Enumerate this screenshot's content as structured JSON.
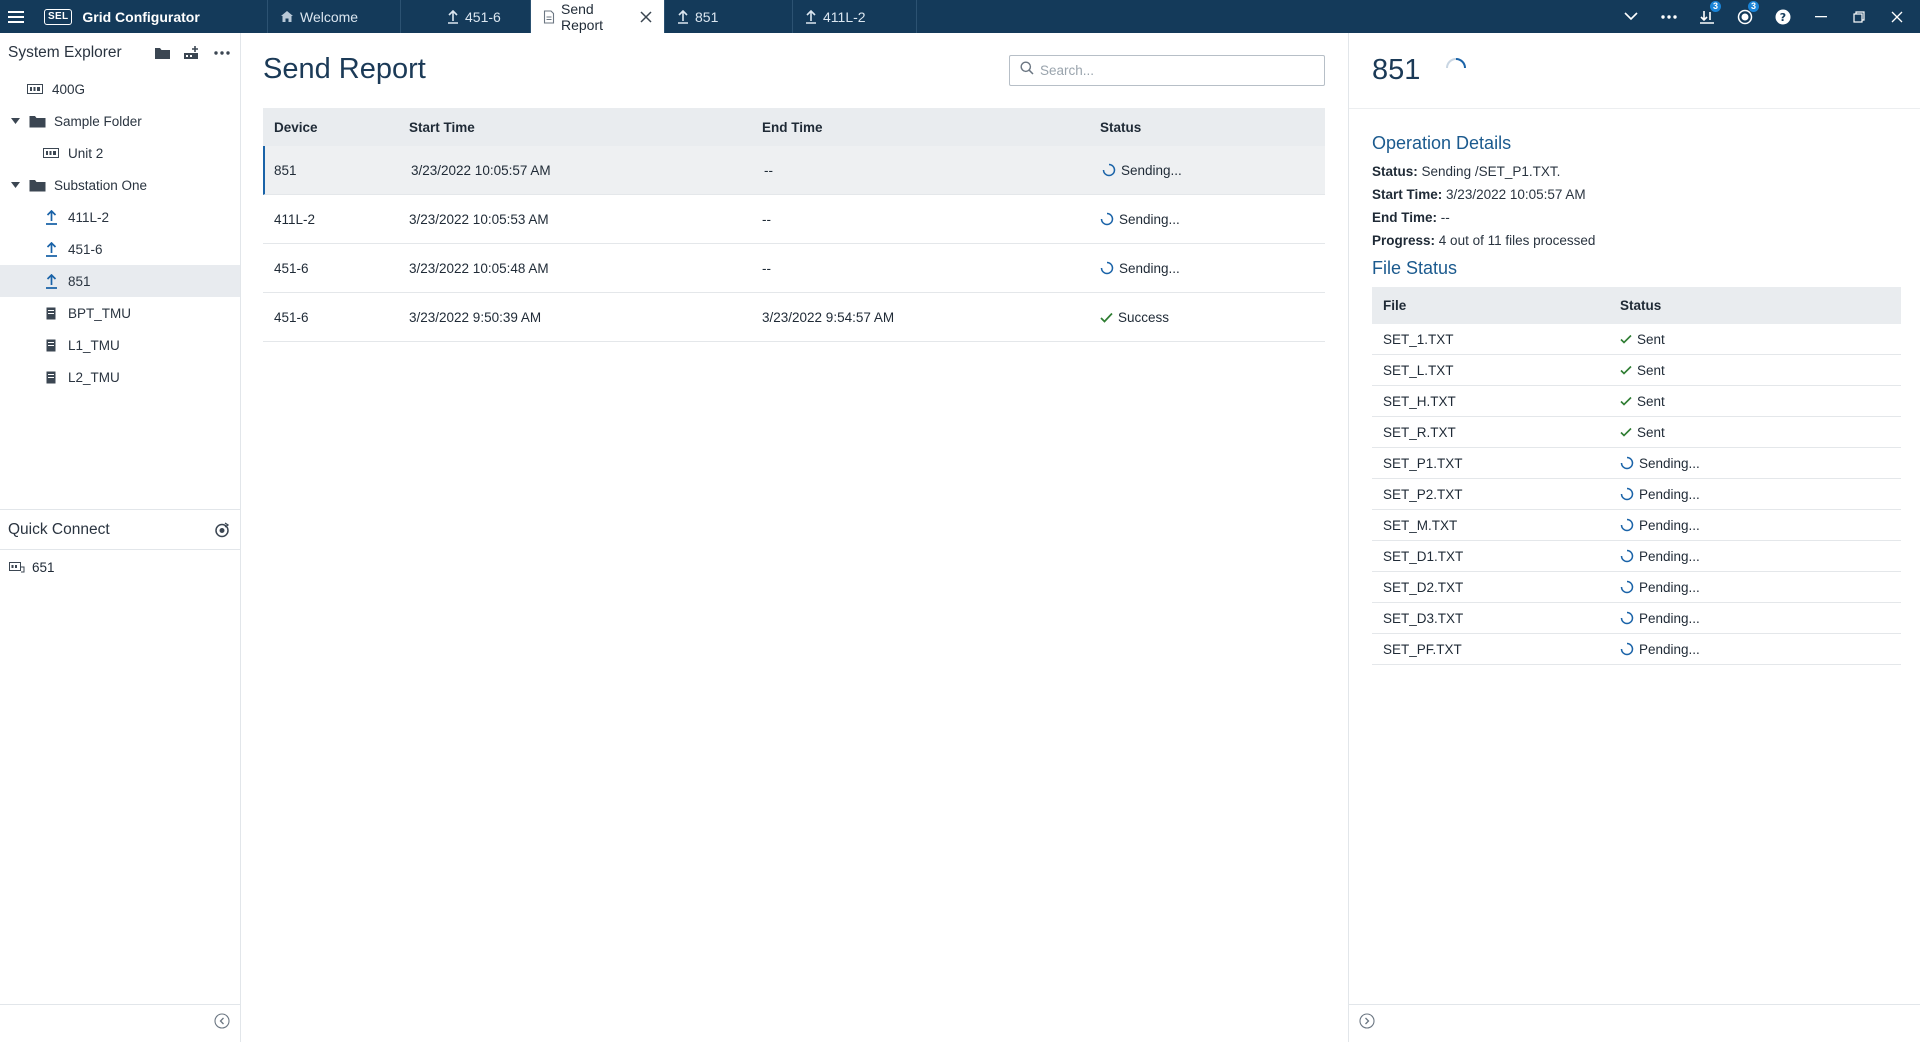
{
  "titlebar": {
    "logo": "SEL",
    "app_name": "Grid Configurator",
    "tabs": [
      {
        "label": "Welcome",
        "icon": "home-icon"
      },
      {
        "label": "451-6",
        "icon": "upload-icon"
      },
      {
        "label": "Send Report",
        "icon": "report-icon"
      },
      {
        "label": "851",
        "icon": "upload-icon"
      },
      {
        "label": "411L-2",
        "icon": "upload-icon"
      }
    ],
    "badges": {
      "transfers": "3",
      "notifications": "3"
    }
  },
  "sidebar": {
    "title": "System Explorer",
    "tree": [
      {
        "label": "400G"
      },
      {
        "label": "Sample Folder"
      },
      {
        "label": "Unit 2"
      },
      {
        "label": "Substation One"
      },
      {
        "label": "411L-2"
      },
      {
        "label": "451-6"
      },
      {
        "label": "851"
      },
      {
        "label": "BPT_TMU"
      },
      {
        "label": "L1_TMU"
      },
      {
        "label": "L2_TMU"
      }
    ],
    "quick_connect": {
      "title": "Quick Connect",
      "items": [
        {
          "label": "651"
        }
      ]
    }
  },
  "main": {
    "title": "Send Report",
    "search_placeholder": "Search...",
    "columns": {
      "device": "Device",
      "start": "Start Time",
      "end": "End Time",
      "status": "Status"
    },
    "rows": [
      {
        "device": "851",
        "start": "3/23/2022 10:05:57 AM",
        "end": "--",
        "status": "Sending..."
      },
      {
        "device": "411L-2",
        "start": "3/23/2022 10:05:53 AM",
        "end": "--",
        "status": "Sending..."
      },
      {
        "device": "451-6",
        "start": "3/23/2022 10:05:48 AM",
        "end": "--",
        "status": "Sending..."
      },
      {
        "device": "451-6",
        "start": "3/23/2022 9:50:39 AM",
        "end": "3/23/2022 9:54:57 AM",
        "status": "Success"
      }
    ]
  },
  "detail": {
    "title": "851",
    "op_title": "Operation Details",
    "status_label": "Status:",
    "status_value": "Sending /SET_P1.TXT.",
    "start_label": "Start Time:",
    "start_value": "3/23/2022 10:05:57 AM",
    "end_label": "End Time:",
    "end_value": "--",
    "progress_label": "Progress:",
    "progress_value": "4 out of 11 files processed",
    "fs_title": "File Status",
    "fs_columns": {
      "file": "File",
      "status": "Status"
    },
    "files": [
      {
        "file": "SET_1.TXT",
        "status": "Sent"
      },
      {
        "file": "SET_L.TXT",
        "status": "Sent"
      },
      {
        "file": "SET_H.TXT",
        "status": "Sent"
      },
      {
        "file": "SET_R.TXT",
        "status": "Sent"
      },
      {
        "file": "SET_P1.TXT",
        "status": "Sending..."
      },
      {
        "file": "SET_P2.TXT",
        "status": "Pending..."
      },
      {
        "file": "SET_M.TXT",
        "status": "Pending..."
      },
      {
        "file": "SET_D1.TXT",
        "status": "Pending..."
      },
      {
        "file": "SET_D2.TXT",
        "status": "Pending..."
      },
      {
        "file": "SET_D3.TXT",
        "status": "Pending..."
      },
      {
        "file": "SET_PF.TXT",
        "status": "Pending..."
      }
    ]
  },
  "colors": {
    "titlebar": "#143a5a",
    "accent": "#1a63a8",
    "success": "#2e7d32",
    "heading": "#1b3a57"
  }
}
